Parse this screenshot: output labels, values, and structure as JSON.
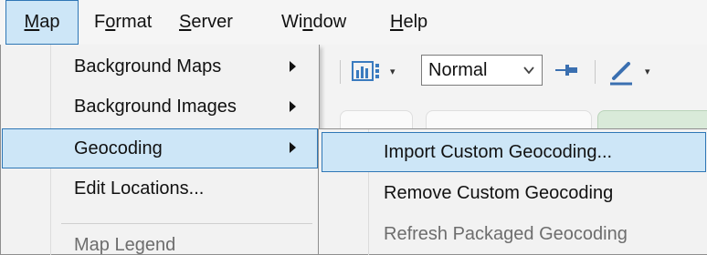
{
  "menubar": {
    "items": [
      {
        "label_pre": "",
        "label_u": "M",
        "label_post": "ap"
      },
      {
        "label_pre": "F",
        "label_u": "o",
        "label_post": "rmat"
      },
      {
        "label_pre": "",
        "label_u": "S",
        "label_post": "erver"
      },
      {
        "label_pre": "Wi",
        "label_u": "n",
        "label_post": "dow"
      },
      {
        "label_pre": "",
        "label_u": "H",
        "label_post": "elp"
      }
    ]
  },
  "toolbar": {
    "mark_size": "Normal",
    "icons": [
      "bar-chart-icon",
      "pin-icon",
      "pen-icon"
    ]
  },
  "map_menu": {
    "items": [
      {
        "label": "Background Maps",
        "has_submenu": true
      },
      {
        "label": "Background Images",
        "has_submenu": true
      },
      {
        "label": "Geocoding",
        "has_submenu": true
      },
      {
        "label": "Edit Locations...",
        "has_submenu": false
      },
      {
        "label": "Map Legend",
        "has_submenu": false
      }
    ]
  },
  "geocoding_submenu": {
    "items": [
      {
        "label": "Import Custom Geocoding...",
        "enabled": true
      },
      {
        "label": "Remove Custom Geocoding",
        "enabled": true
      },
      {
        "label": "Refresh Packaged Geocoding",
        "enabled": false
      }
    ]
  },
  "colors": {
    "highlight_bg": "#cde6f7",
    "highlight_border": "#2f77b6",
    "menu_bg": "#f2f2f2"
  }
}
